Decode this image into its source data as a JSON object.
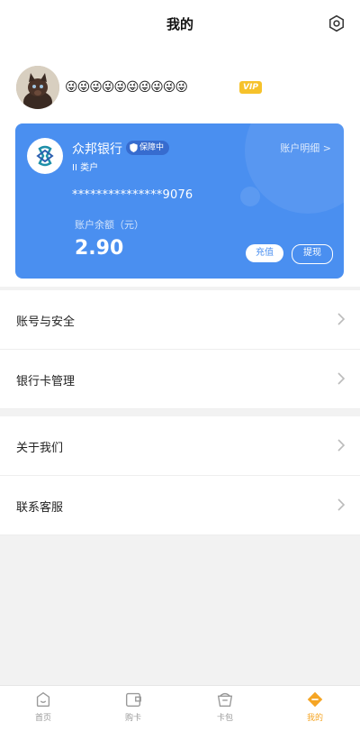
{
  "header": {
    "title": "我的",
    "settings_icon": "gear-icon"
  },
  "profile": {
    "nickname": "😜😜😜😜😜😜😜😜😜😜",
    "vip_badge": "VIP"
  },
  "card": {
    "bank_name": "众邦银行",
    "protection_badge": "保障中",
    "account_type": "II 类户",
    "detail_link": "账户明细 >",
    "account_number": "***************9076",
    "balance_label": "账户余额（元）",
    "balance": "2.90",
    "recharge_label": "充值",
    "withdraw_label": "提现",
    "color": "#4a8ff0"
  },
  "menu_group1": [
    {
      "label": "账号与安全"
    },
    {
      "label": "银行卡管理"
    }
  ],
  "menu_group2": [
    {
      "label": "关于我们"
    },
    {
      "label": "联系客服"
    }
  ],
  "bottom_nav": [
    {
      "label": "首页",
      "icon": "home-icon"
    },
    {
      "label": "购卡",
      "icon": "buy-card-icon"
    },
    {
      "label": "卡包",
      "icon": "card-wallet-icon"
    },
    {
      "label": "我的",
      "icon": "profile-icon",
      "active": true
    }
  ],
  "accent_color": "#f5a524"
}
